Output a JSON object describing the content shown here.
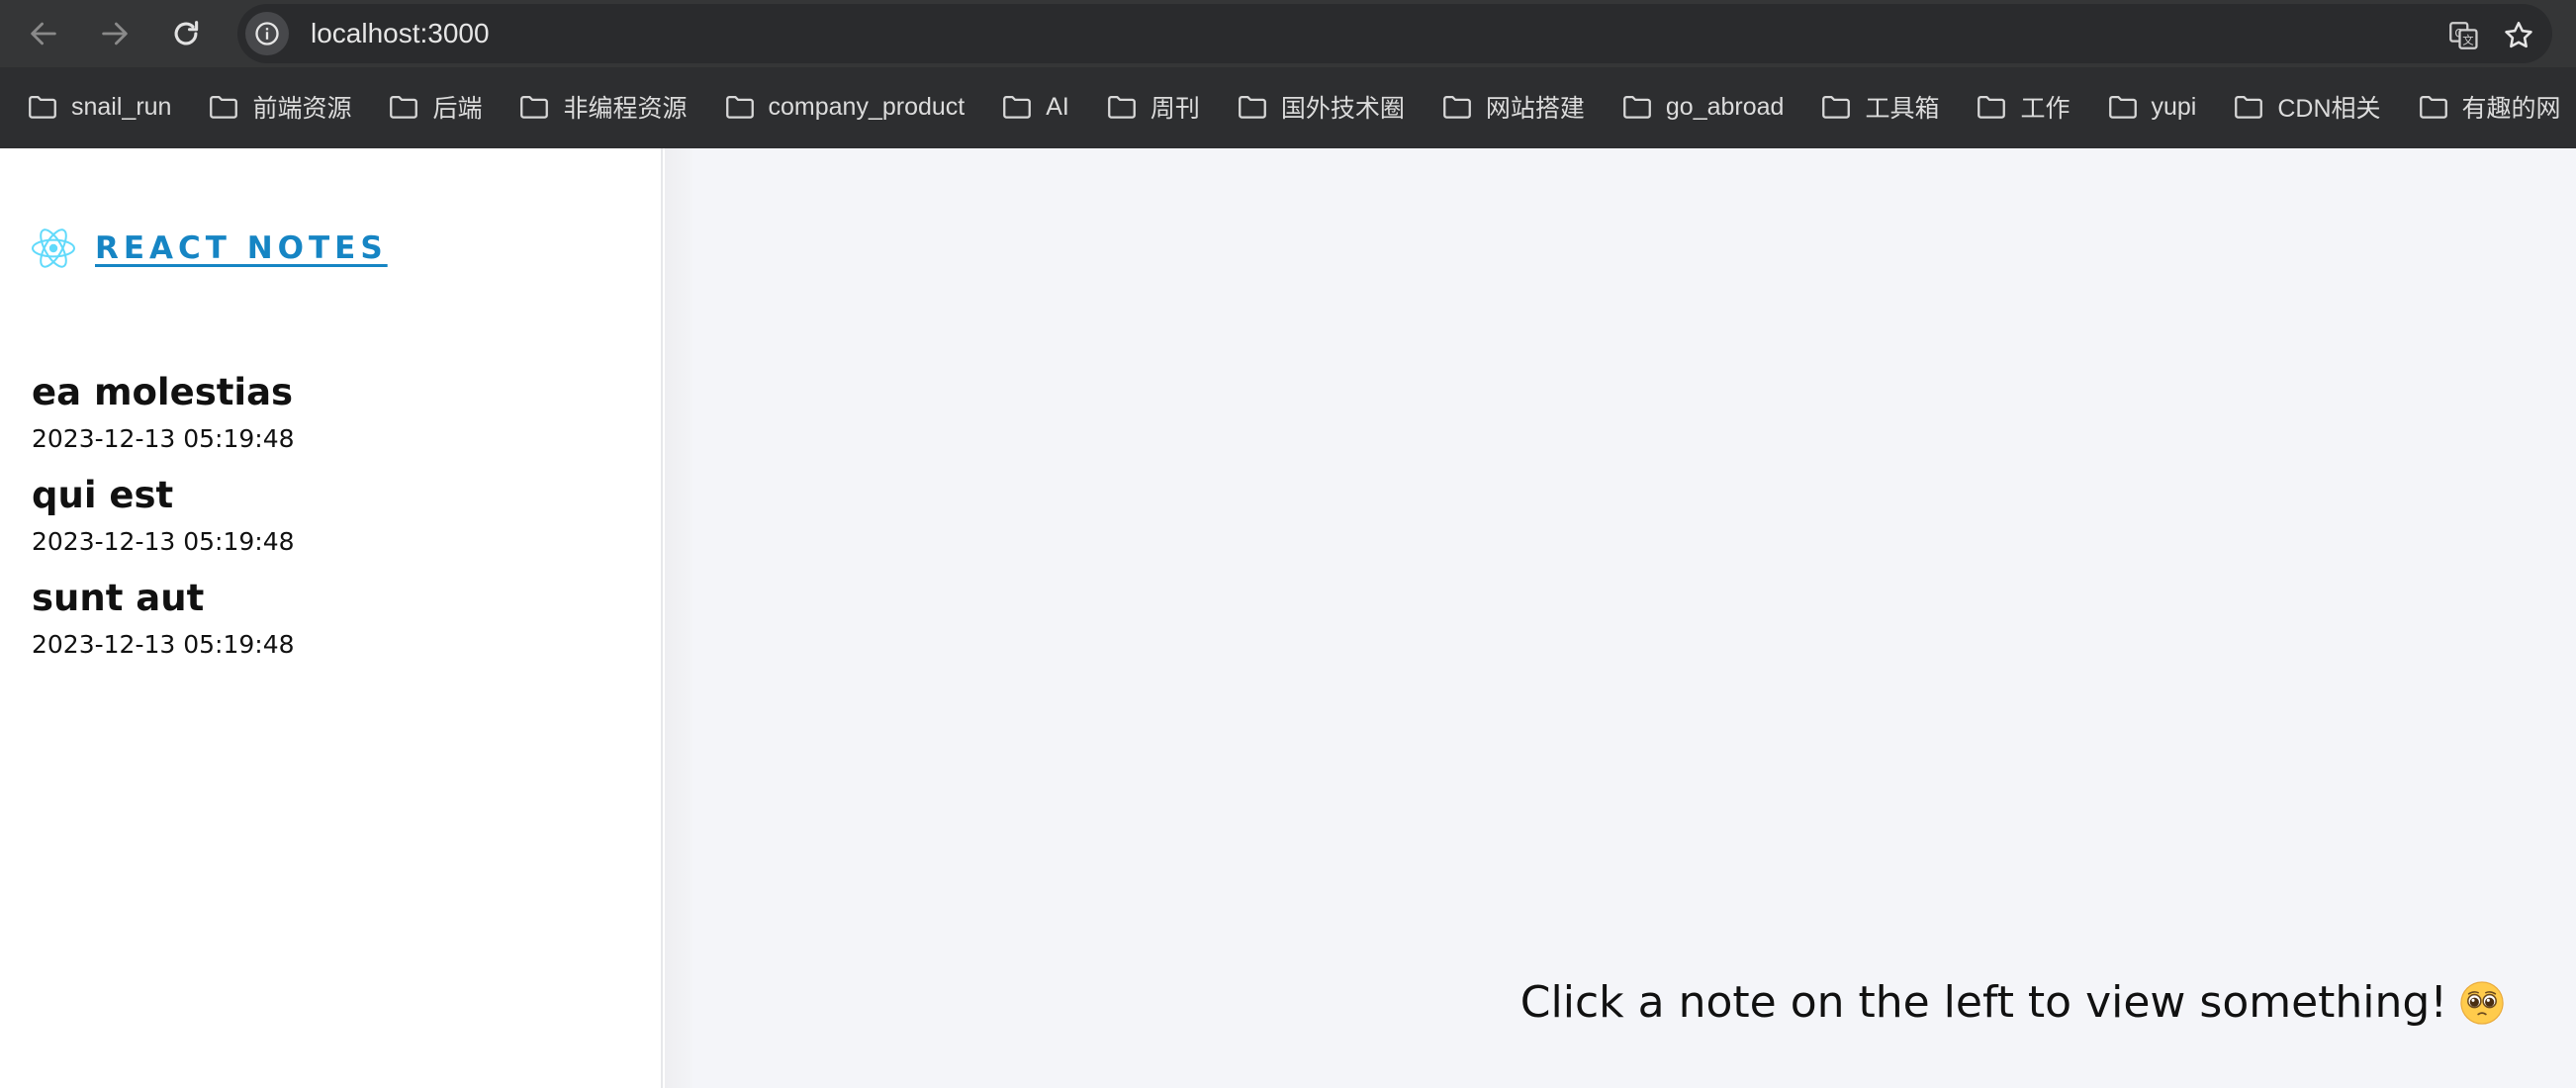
{
  "browser": {
    "url": "localhost:3000",
    "icons": {
      "back": "arrow-left-icon",
      "forward": "arrow-right-icon",
      "reload": "reload-icon",
      "site_info": "info-icon",
      "translate": "translate-icon",
      "bookmark": "star-icon",
      "folder": "folder-icon"
    },
    "bookmarks": [
      {
        "label": "snail_run"
      },
      {
        "label": "前端资源"
      },
      {
        "label": "后端"
      },
      {
        "label": "非编程资源"
      },
      {
        "label": "company_product"
      },
      {
        "label": "AI"
      },
      {
        "label": "周刊"
      },
      {
        "label": "国外技术圈"
      },
      {
        "label": "网站搭建"
      },
      {
        "label": "go_abroad"
      },
      {
        "label": "工具箱"
      },
      {
        "label": "工作"
      },
      {
        "label": "yupi"
      },
      {
        "label": "CDN相关"
      },
      {
        "label": "有趣的网"
      }
    ]
  },
  "app": {
    "brand": "REACT NOTES",
    "brand_icon": "react-logo-icon",
    "brand_color": "#1685c4",
    "notes": [
      {
        "title": "ea molestias",
        "date": "2023-12-13 05:19:48"
      },
      {
        "title": "qui est",
        "date": "2023-12-13 05:19:48"
      },
      {
        "title": "sunt aut",
        "date": "2023-12-13 05:19:48"
      }
    ],
    "empty_message": "Click a note on the left to view something!",
    "empty_emoji": "pleading-face-emoji"
  }
}
